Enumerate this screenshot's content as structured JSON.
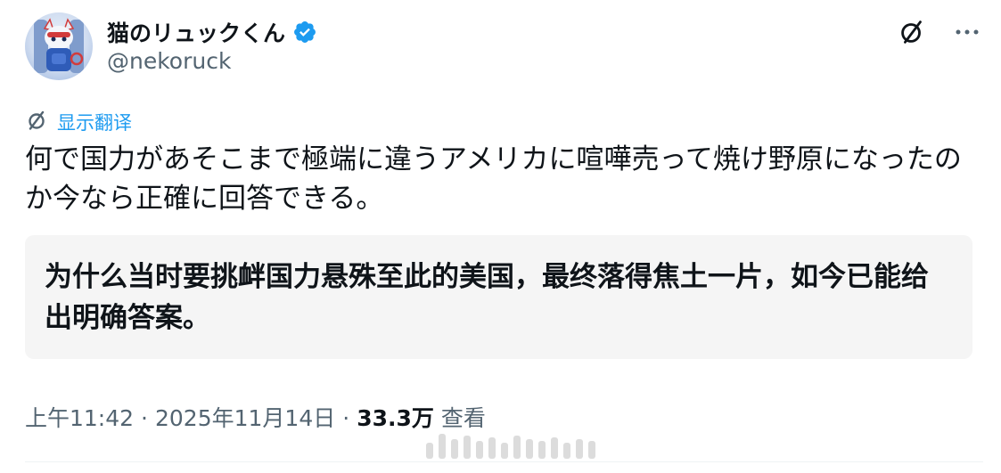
{
  "user": {
    "display_name": "猫のリュックくん",
    "handle": "@nekoruck",
    "verified": true
  },
  "icons": {
    "verified": "verified-badge-icon",
    "translate": "translate-icon",
    "more": "more-icon"
  },
  "translate": {
    "label": "显示翻译"
  },
  "tweet": {
    "text": "何で国力があそこまで極端に違うアメリカに喧嘩売って焼け野原になったのか今なら正確に回答できる。"
  },
  "translation": {
    "text": "为什么当时要挑衅国力悬殊至此的美国，最终落得焦土一片，如今已能给出明确答案。"
  },
  "meta": {
    "time": "上午11:42",
    "date": "2025年11月14日",
    "separator": "·",
    "views_count": "33.3万",
    "views_label": "查看"
  },
  "colors": {
    "accent": "#1d9bf0",
    "text": "#0f1419",
    "secondary": "#536471",
    "translation_bg": "#f5f5f5"
  }
}
